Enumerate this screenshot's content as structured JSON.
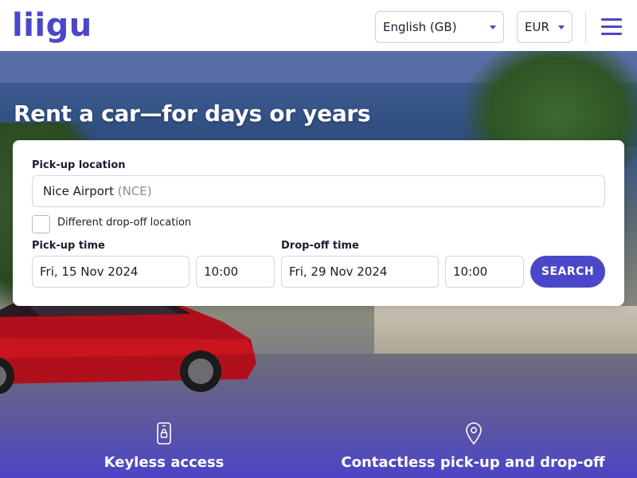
{
  "header": {
    "logo": "liigu",
    "language": "English (GB)",
    "currency": "EUR"
  },
  "hero": {
    "title": "Rent a car—for days or years"
  },
  "search": {
    "pickup_location_label": "Pick-up location",
    "pickup_location_value": "Nice Airport",
    "pickup_location_code": "(NCE)",
    "different_dropoff_label": "Different drop-off location",
    "different_dropoff_checked": false,
    "pickup_time_label": "Pick-up time",
    "pickup_date": "Fri, 15 Nov 2024",
    "pickup_hour": "10:00",
    "dropoff_time_label": "Drop-off time",
    "dropoff_date": "Fri, 29 Nov 2024",
    "dropoff_hour": "10:00",
    "search_button": "SEARCH"
  },
  "features": [
    {
      "icon": "phone-lock-icon",
      "label": "Keyless access"
    },
    {
      "icon": "location-pin-icon",
      "label": "Contactless pick-up and drop-off"
    }
  ],
  "colors": {
    "brand": "#4a47c9",
    "text": "#1c1c2e",
    "muted": "#8c8c99"
  }
}
